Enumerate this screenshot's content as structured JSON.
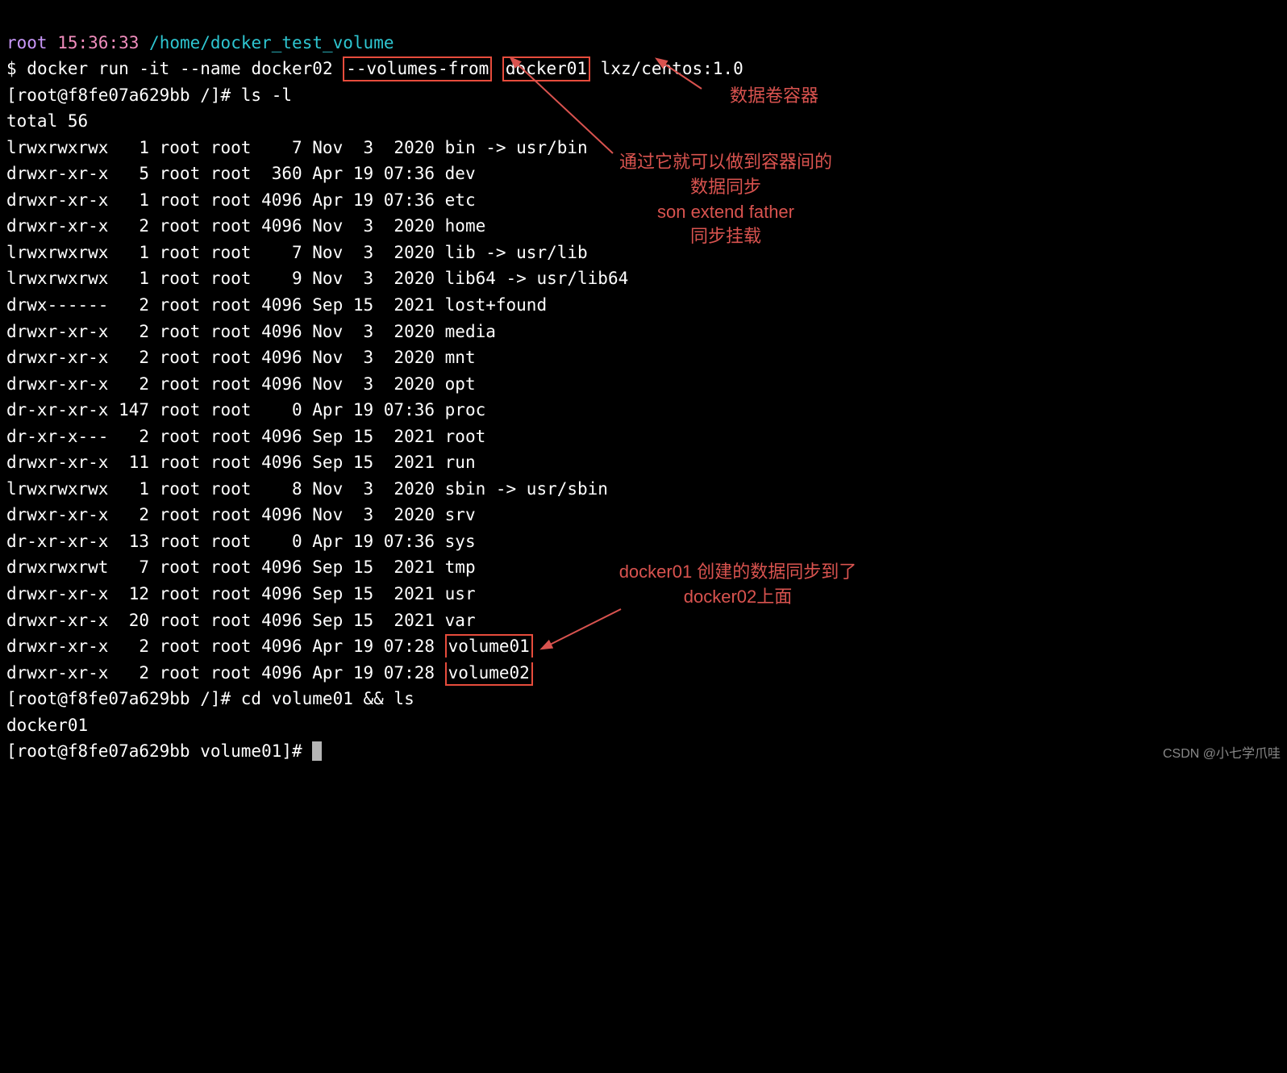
{
  "prompt": {
    "user": "root",
    "time": "15:36:33",
    "path": "/home/docker_test_volume"
  },
  "command": {
    "dollar": "$",
    "pre": " docker run -it --name docker02 ",
    "volumes_from": "--volumes-from",
    "gap": " ",
    "docker01": "docker01",
    "post": " lxz/centos:1.0"
  },
  "shell_prompt1": "[root@f8fe07a629bb /]# ls -l",
  "total": "total 56",
  "rows": [
    "lrwxrwxrwx   1 root root    7 Nov  3  2020 bin -> usr/bin",
    "drwxr-xr-x   5 root root  360 Apr 19 07:36 dev",
    "drwxr-xr-x   1 root root 4096 Apr 19 07:36 etc",
    "drwxr-xr-x   2 root root 4096 Nov  3  2020 home",
    "lrwxrwxrwx   1 root root    7 Nov  3  2020 lib -> usr/lib",
    "lrwxrwxrwx   1 root root    9 Nov  3  2020 lib64 -> usr/lib64",
    "drwx------   2 root root 4096 Sep 15  2021 lost+found",
    "drwxr-xr-x   2 root root 4096 Nov  3  2020 media",
    "drwxr-xr-x   2 root root 4096 Nov  3  2020 mnt",
    "drwxr-xr-x   2 root root 4096 Nov  3  2020 opt",
    "dr-xr-xr-x 147 root root    0 Apr 19 07:36 proc",
    "dr-xr-x---   2 root root 4096 Sep 15  2021 root",
    "drwxr-xr-x  11 root root 4096 Sep 15  2021 run",
    "lrwxrwxrwx   1 root root    8 Nov  3  2020 sbin -> usr/sbin",
    "drwxr-xr-x   2 root root 4096 Nov  3  2020 srv",
    "dr-xr-xr-x  13 root root    0 Apr 19 07:36 sys",
    "drwxrwxrwt   7 root root 4096 Sep 15  2021 tmp",
    "drwxr-xr-x  12 root root 4096 Sep 15  2021 usr",
    "drwxr-xr-x  20 root root 4096 Sep 15  2021 var"
  ],
  "vol_rows": {
    "r1_pre": "drwxr-xr-x   2 root root 4096 Apr 19 07:28 ",
    "r1_name": "volume01",
    "r2_pre": "drwxr-xr-x   2 root root 4096 Apr 19 07:28 ",
    "r2_name": "volume02"
  },
  "shell_prompt2": "[root@f8fe07a629bb /]# cd volume01 && ls",
  "output2": "docker01",
  "shell_prompt3": "[root@f8fe07a629bb volume01]# ",
  "annotations": {
    "a1": "数据卷容器",
    "a2": "通过它就可以做到容器间的\n数据同步\nson extend father\n同步挂载",
    "a3": "docker01 创建的数据同步到了docker02上面"
  },
  "watermark": "CSDN @小七学爪哇"
}
